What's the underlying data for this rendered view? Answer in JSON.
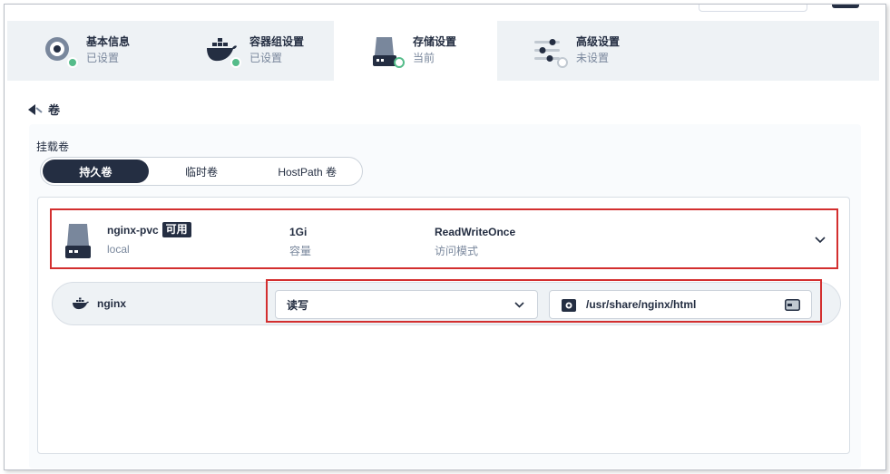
{
  "steps": [
    {
      "title": "基本信息",
      "status": "已设置",
      "icon": "basic-info-icon",
      "state": "done"
    },
    {
      "title": "容器组设置",
      "status": "已设置",
      "icon": "docker-icon",
      "state": "done"
    },
    {
      "title": "存储设置",
      "status": "当前",
      "icon": "storage-icon",
      "state": "current"
    },
    {
      "title": "高级设置",
      "status": "未设置",
      "icon": "advanced-settings-icon",
      "state": "todo"
    }
  ],
  "back": {
    "label": "卷"
  },
  "mount": {
    "label": "挂载卷",
    "tabs": [
      "持久卷",
      "临时卷",
      "HostPath 卷"
    ],
    "active_tab": "持久卷"
  },
  "volume": {
    "name": "nginx-pvc",
    "badge": "可用",
    "storage_class": "local",
    "capacity_value": "1Gi",
    "capacity_label": "容量",
    "access_value": "ReadWriteOnce",
    "access_label": "访问模式"
  },
  "container_mount": {
    "container": "nginx",
    "mode": "读写",
    "path": "/usr/share/nginx/html"
  },
  "colors": {
    "dark": "#242e42",
    "green": "#55bc8a",
    "highlight": "#d32f2f"
  }
}
